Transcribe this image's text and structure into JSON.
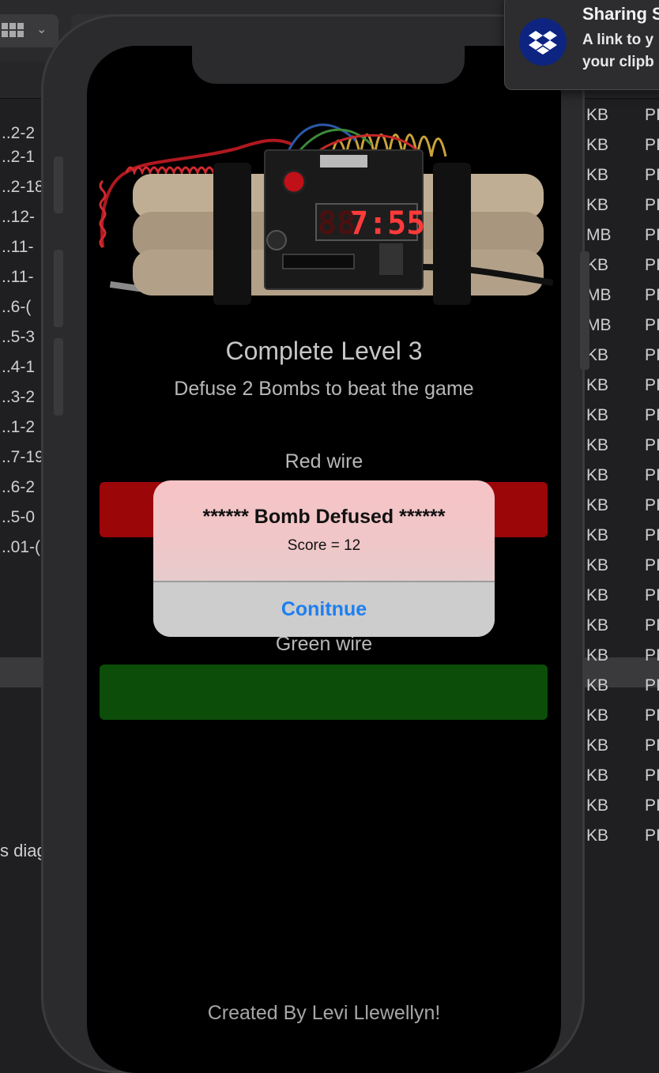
{
  "background": {
    "left_items": [
      "..2-2",
      "..2-1",
      "..2-18",
      "..12-",
      "..11-",
      "..11-",
      "..6-(",
      "..5-3",
      "..4-1",
      "..3-2",
      "..1-2",
      "..7-19",
      "..6-2",
      "..5-0",
      "..01-("
    ],
    "left_bottom_text": "s diag",
    "right_rows": [
      {
        "size": "KB",
        "kind": "PI"
      },
      {
        "size": "KB",
        "kind": "PI"
      },
      {
        "size": "KB",
        "kind": "PI"
      },
      {
        "size": "KB",
        "kind": "PI"
      },
      {
        "size": "MB",
        "kind": "PI"
      },
      {
        "size": "KB",
        "kind": "PI"
      },
      {
        "size": "MB",
        "kind": "PI"
      },
      {
        "size": "MB",
        "kind": "PI"
      },
      {
        "size": "KB",
        "kind": "PI"
      },
      {
        "size": "KB",
        "kind": "PI"
      },
      {
        "size": "KB",
        "kind": "PI"
      },
      {
        "size": "KB",
        "kind": "PI"
      },
      {
        "size": "KB",
        "kind": "PI"
      },
      {
        "size": "KB",
        "kind": "PI"
      },
      {
        "size": "KB",
        "kind": "PI"
      },
      {
        "size": "KB",
        "kind": "PI"
      },
      {
        "size": "KB",
        "kind": "PI"
      },
      {
        "size": "KB",
        "kind": "PI"
      },
      {
        "size": "KB",
        "kind": "PI"
      },
      {
        "size": "KB",
        "kind": "PI"
      },
      {
        "size": "KB",
        "kind": "PI"
      },
      {
        "size": "KB",
        "kind": "PI"
      },
      {
        "size": "KB",
        "kind": "PI"
      },
      {
        "size": "KB",
        "kind": "PI"
      },
      {
        "size": "KB",
        "kind": "PI"
      }
    ]
  },
  "notification": {
    "title": "Sharing S",
    "line1": "A link to y",
    "line2": "your clipb",
    "icon": "dropbox-icon"
  },
  "app": {
    "bomb_timer": "7:55",
    "level_title": "Complete Level 3",
    "subtitle": "Defuse 2 Bombs to beat the game",
    "red_wire_label": "Red wire",
    "green_wire_label": "Green wire",
    "credit": "Created By Levi Llewellyn!",
    "colors": {
      "red_wire": "#9b0609",
      "green_wire": "#0b4d09",
      "alert_button": "#1e7ff0"
    }
  },
  "alert": {
    "title": "****** Bomb Defused ******",
    "message": "Score = 12",
    "button": "Conitnue"
  }
}
